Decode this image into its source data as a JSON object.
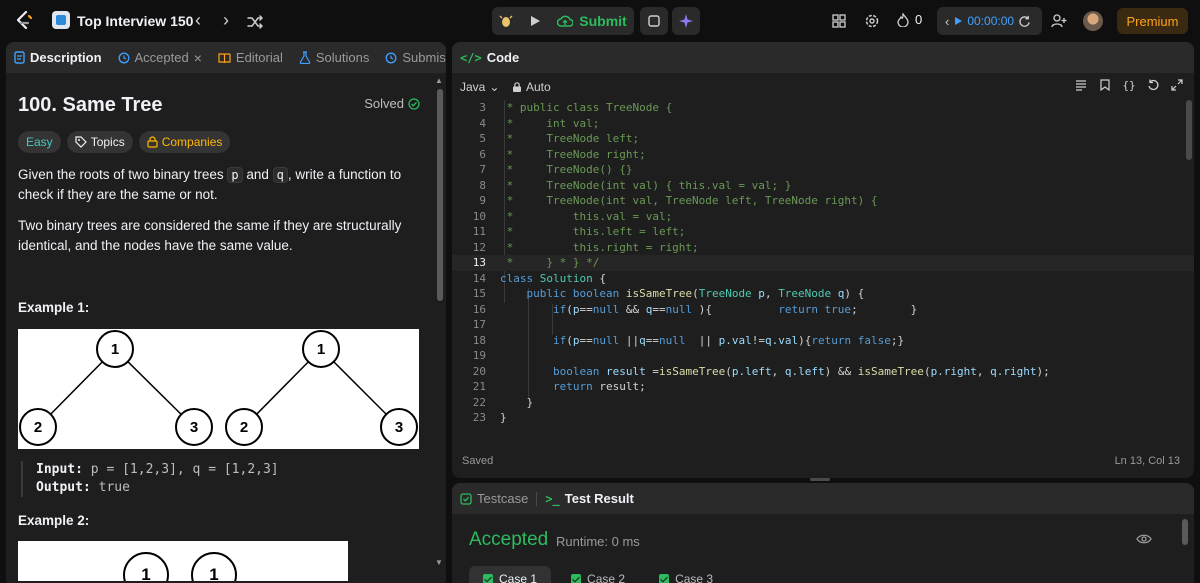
{
  "topnav": {
    "list_title": "Top Interview 150",
    "submit_label": "Submit",
    "streak_count": "0",
    "timer": "00:00:00",
    "premium_label": "Premium"
  },
  "left_panel": {
    "tabs": [
      {
        "label": "Description"
      },
      {
        "label": "Accepted"
      },
      {
        "label": "Editorial"
      },
      {
        "label": "Solutions"
      },
      {
        "label": "Submissi"
      }
    ],
    "title": "100. Same Tree",
    "status": "Solved",
    "pills": {
      "difficulty": "Easy",
      "topics": "Topics",
      "companies": "Companies"
    },
    "para1": {
      "a": "Given the roots of two binary trees ",
      "p": "p",
      "and": " and ",
      "q": "q",
      "b": ", write a function to check if they are the same or not."
    },
    "para2": "Two binary trees are considered the same if they are structurally identical, and the nodes have the same value.",
    "example1": {
      "title": "Example 1:",
      "tree_left": {
        "root": "1",
        "left": "2",
        "right": "3"
      },
      "tree_right": {
        "root": "1",
        "left": "2",
        "right": "3"
      },
      "input_label": "Input:",
      "input_value": "p = [1,2,3], q = [1,2,3]",
      "output_label": "Output:",
      "output_value": "true"
    },
    "example2": {
      "title": "Example 2:",
      "node_a": "1",
      "node_b": "1"
    }
  },
  "code_panel": {
    "tab_label": "Code",
    "language": "Java",
    "mode": "Auto",
    "status_left": "Saved",
    "status_right": "Ln 13, Col 13",
    "lines": [
      {
        "n": "3",
        "tokens": [
          [
            "c-com",
            " * public class TreeNode {"
          ]
        ]
      },
      {
        "n": "4",
        "tokens": [
          [
            "c-com",
            " *     int val;"
          ]
        ]
      },
      {
        "n": "5",
        "tokens": [
          [
            "c-com",
            " *     TreeNode left;"
          ]
        ]
      },
      {
        "n": "6",
        "tokens": [
          [
            "c-com",
            " *     TreeNode right;"
          ]
        ]
      },
      {
        "n": "7",
        "tokens": [
          [
            "c-com",
            " *     TreeNode() {}"
          ]
        ]
      },
      {
        "n": "8",
        "tokens": [
          [
            "c-com",
            " *     TreeNode(int val) { this.val = val; }"
          ]
        ]
      },
      {
        "n": "9",
        "tokens": [
          [
            "c-com",
            " *     TreeNode(int val, TreeNode left, TreeNode right) {"
          ]
        ]
      },
      {
        "n": "10",
        "tokens": [
          [
            "c-com",
            " *         this.val = val;"
          ]
        ]
      },
      {
        "n": "11",
        "tokens": [
          [
            "c-com",
            " *         this.left = left;"
          ]
        ]
      },
      {
        "n": "12",
        "tokens": [
          [
            "c-com",
            " *         this.right = right;"
          ]
        ]
      },
      {
        "n": "13",
        "tokens": [
          [
            "c-com",
            " *     } * } */"
          ]
        ]
      },
      {
        "n": "14",
        "tokens": [
          [
            "c-kw",
            "class "
          ],
          [
            "c-cls",
            "Solution"
          ],
          [
            "c-txt",
            " {"
          ]
        ]
      },
      {
        "n": "15",
        "tokens": [
          [
            "c-txt",
            "    "
          ],
          [
            "c-kw",
            "public boolean "
          ],
          [
            "c-fn",
            "isSameTree"
          ],
          [
            "c-txt",
            "("
          ],
          [
            "c-cls",
            "TreeNode"
          ],
          [
            "c-var",
            " p"
          ],
          [
            "c-txt",
            ", "
          ],
          [
            "c-cls",
            "TreeNode"
          ],
          [
            "c-var",
            " q"
          ],
          [
            "c-txt",
            ") {"
          ]
        ]
      },
      {
        "n": "16",
        "tokens": [
          [
            "c-txt",
            "        "
          ],
          [
            "c-kw",
            "if"
          ],
          [
            "c-txt",
            "("
          ],
          [
            "c-var",
            "p"
          ],
          [
            "c-txt",
            "=="
          ],
          [
            "c-kw",
            "null"
          ],
          [
            "c-txt",
            " && "
          ],
          [
            "c-var",
            "q"
          ],
          [
            "c-txt",
            "=="
          ],
          [
            "c-kw",
            "null"
          ],
          [
            "c-txt",
            " ){          "
          ],
          [
            "c-kw",
            "return true"
          ],
          [
            "c-txt",
            ";        }"
          ]
        ]
      },
      {
        "n": "17",
        "tokens": [
          [
            "c-txt",
            ""
          ]
        ]
      },
      {
        "n": "18",
        "tokens": [
          [
            "c-txt",
            "        "
          ],
          [
            "c-kw",
            "if"
          ],
          [
            "c-txt",
            "("
          ],
          [
            "c-var",
            "p"
          ],
          [
            "c-txt",
            "=="
          ],
          [
            "c-kw",
            "null"
          ],
          [
            "c-txt",
            " ||"
          ],
          [
            "c-var",
            "q"
          ],
          [
            "c-txt",
            "=="
          ],
          [
            "c-kw",
            "null"
          ],
          [
            "c-txt",
            "  || "
          ],
          [
            "c-var",
            "p.val"
          ],
          [
            "c-txt",
            "!="
          ],
          [
            "c-var",
            "q.val"
          ],
          [
            "c-txt",
            "){"
          ],
          [
            "c-kw",
            "return false"
          ],
          [
            "c-txt",
            ";}"
          ]
        ]
      },
      {
        "n": "19",
        "tokens": [
          [
            "c-txt",
            ""
          ]
        ]
      },
      {
        "n": "20",
        "tokens": [
          [
            "c-txt",
            "        "
          ],
          [
            "c-kw",
            "boolean "
          ],
          [
            "c-var",
            "result"
          ],
          [
            "c-txt",
            " ="
          ],
          [
            "c-fn",
            "isSameTree"
          ],
          [
            "c-txt",
            "("
          ],
          [
            "c-var",
            "p.left"
          ],
          [
            "c-txt",
            ", "
          ],
          [
            "c-var",
            "q.left"
          ],
          [
            "c-txt",
            ") && "
          ],
          [
            "c-fn",
            "isSameTree"
          ],
          [
            "c-txt",
            "("
          ],
          [
            "c-var",
            "p.right"
          ],
          [
            "c-txt",
            ", "
          ],
          [
            "c-var",
            "q.right"
          ],
          [
            "c-txt",
            ");"
          ]
        ]
      },
      {
        "n": "21",
        "tokens": [
          [
            "c-txt",
            "        "
          ],
          [
            "c-kw",
            "return "
          ],
          [
            "c-txt",
            "result;"
          ]
        ]
      },
      {
        "n": "22",
        "tokens": [
          [
            "c-txt",
            "    }"
          ]
        ]
      },
      {
        "n": "23",
        "tokens": [
          [
            "c-txt",
            "}"
          ]
        ]
      }
    ],
    "current_line": "13"
  },
  "test_panel": {
    "tabs": [
      {
        "label": "Testcase"
      },
      {
        "label": "Test Result"
      }
    ],
    "result": "Accepted",
    "runtime": "Runtime: 0 ms",
    "cases": [
      "Case 1",
      "Case 2",
      "Case 3"
    ]
  },
  "colors": {
    "accent_green": "#2cbb5d",
    "premium": "#ffa116",
    "timer_blue": "#3fa0ff"
  }
}
